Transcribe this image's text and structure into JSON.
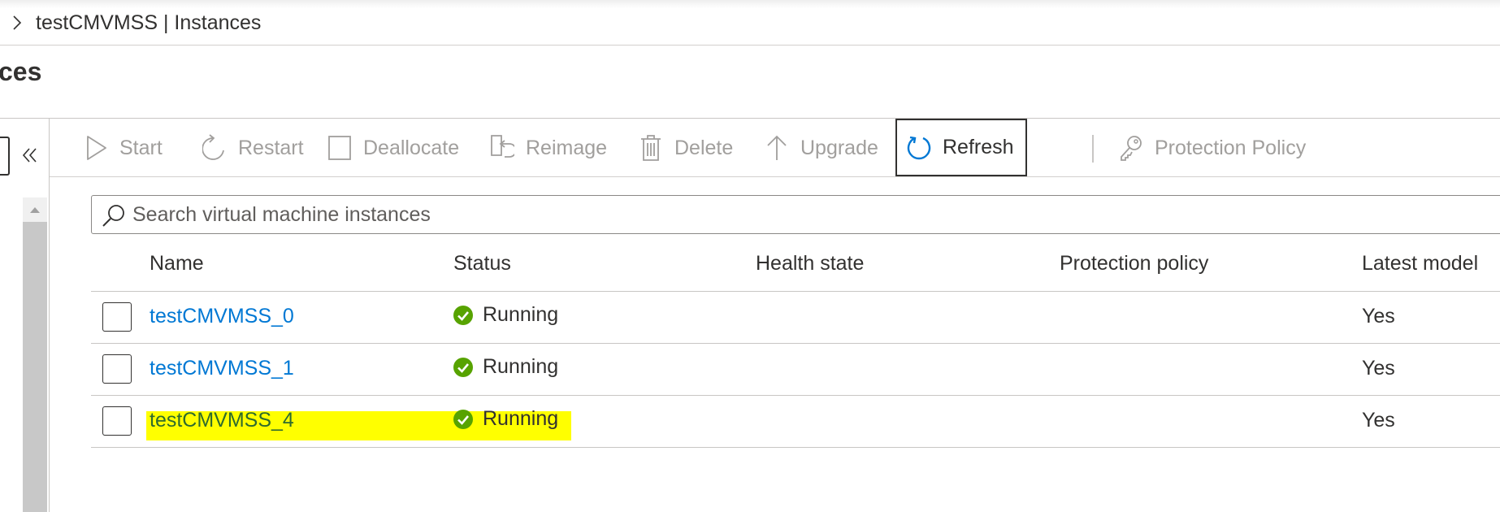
{
  "breadcrumb": {
    "text": "testCMVMSS | Instances"
  },
  "page": {
    "title": "ces"
  },
  "toolbar": {
    "start": "Start",
    "restart": "Restart",
    "deallocate": "Deallocate",
    "reimage": "Reimage",
    "delete": "Delete",
    "upgrade": "Upgrade",
    "refresh": "Refresh",
    "protection_policy": "Protection Policy"
  },
  "search": {
    "placeholder": "Search virtual machine instances",
    "value": ""
  },
  "table": {
    "headers": {
      "name": "Name",
      "status": "Status",
      "health": "Health state",
      "protection": "Protection policy",
      "latest": "Latest model"
    },
    "rows": [
      {
        "name": "testCMVMSS_0",
        "status": "Running",
        "health": "",
        "protection": "",
        "latest": "Yes"
      },
      {
        "name": "testCMVMSS_1",
        "status": "Running",
        "health": "",
        "protection": "",
        "latest": "Yes"
      },
      {
        "name": "testCMVMSS_4",
        "status": "Running",
        "health": "",
        "protection": "",
        "latest": "Yes",
        "highlighted": true
      }
    ]
  },
  "colors": {
    "link": "#0078d4",
    "success": "#57a300",
    "highlight": "#ffff00",
    "disabled": "#a19f9d",
    "refresh_icon": "#0078d4"
  },
  "icons": {
    "breadcrumb": "chevron-right-icon",
    "collapse": "double-chevron-left-icon",
    "start": "play-icon",
    "restart": "restart-icon",
    "deallocate": "stop-square-icon",
    "reimage": "reimage-icon",
    "delete": "trash-icon",
    "upgrade": "arrow-up-icon",
    "refresh": "refresh-icon",
    "protection_policy": "key-icon",
    "search": "search-icon",
    "status": "check-circle-icon"
  }
}
